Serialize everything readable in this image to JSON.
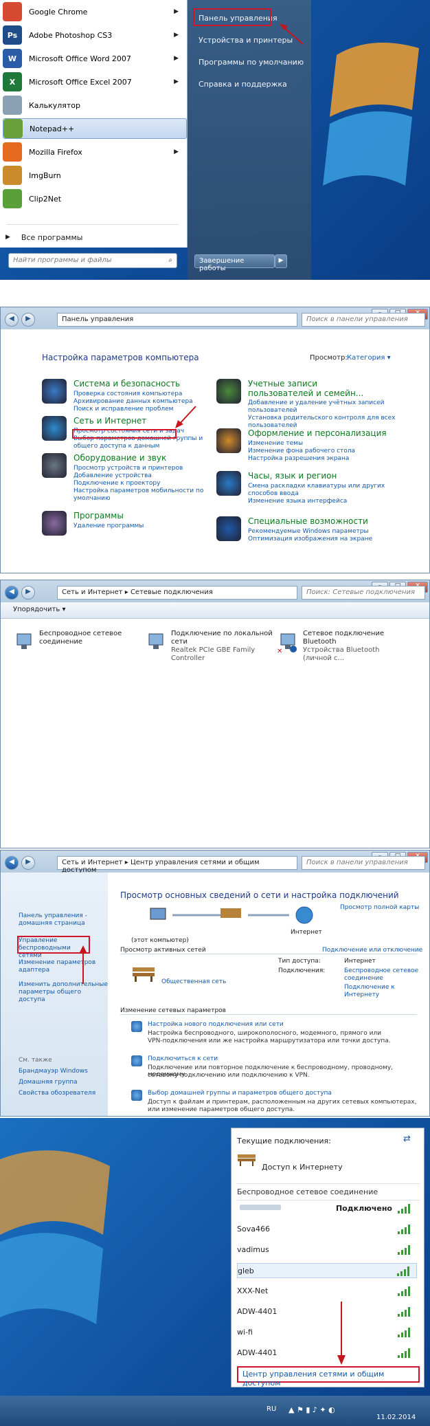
{
  "start_menu": {
    "programs": [
      {
        "label": "Google Chrome",
        "icon": "chrome-icon",
        "color": "#d64933",
        "arrow": true
      },
      {
        "label": "Adobe Photoshop CS3",
        "icon": "photoshop-icon",
        "color": "#1f4d8a",
        "arrow": true,
        "abbr": "Ps"
      },
      {
        "label": "Microsoft Office Word 2007",
        "icon": "word-icon",
        "color": "#2b5ca8",
        "arrow": true,
        "abbr": "W"
      },
      {
        "label": "Microsoft Office Excel 2007",
        "icon": "excel-icon",
        "color": "#1f7a3a",
        "arrow": true,
        "abbr": "X"
      },
      {
        "label": "Калькулятор",
        "icon": "calculator-icon",
        "color": "#8aa0b5",
        "arrow": false
      },
      {
        "label": "Notepad++",
        "icon": "notepadpp-icon",
        "color": "#6aa03a",
        "arrow": false
      },
      {
        "label": "Mozilla Firefox",
        "icon": "firefox-icon",
        "color": "#e66a1f",
        "arrow": true
      },
      {
        "label": "ImgBurn",
        "icon": "imgburn-icon",
        "color": "#c98b2b",
        "arrow": false
      },
      {
        "label": "Clip2Net",
        "icon": "clip2net-icon",
        "color": "#5aa03a",
        "arrow": false
      }
    ],
    "all_programs": "Все программы",
    "search_placeholder": "Найти программы и файлы",
    "right_items": [
      "Панель управления",
      "Устройства и принтеры",
      "Программы по умолчанию",
      "Справка и поддержка"
    ],
    "shutdown": "Завершение работы"
  },
  "control_panel": {
    "address": "Панель управления",
    "search": "Поиск в панели управления",
    "heading": "Настройка параметров компьютера",
    "view_label": "Просмотр:",
    "view_value": "Категория",
    "categories_left": [
      {
        "title": "Система и безопасность",
        "links": [
          "Проверка состояния компьютера",
          "Архивирование данных компьютера",
          "Поиск и исправление проблем"
        ],
        "icon": "shield-icon",
        "color": "#3a7bc8"
      },
      {
        "title": "Сеть и Интернет",
        "links": [
          "Просмотр состояния сети и задач",
          "Выбор параметров домашней группы и",
          "общего доступа к данным"
        ],
        "icon": "network-globe-icon",
        "color": "#2e8bd0"
      },
      {
        "title": "Оборудование и звук",
        "links": [
          "Просмотр устройств и принтеров",
          "Добавление устройства",
          "Подключение к проектору",
          "Настройка параметров мобильности по",
          "умолчанию"
        ],
        "icon": "printer-icon",
        "color": "#6a7680"
      },
      {
        "title": "Программы",
        "links": [
          "Удаление программы"
        ],
        "icon": "programs-icon",
        "color": "#8a6aa0"
      }
    ],
    "categories_right": [
      {
        "title": "Учетные записи пользователей и семейн...",
        "links": [
          "Добавление и удаление учётных записей",
          "пользователей",
          "Установка родительского контроля для всех",
          "пользователей"
        ],
        "icon": "users-icon",
        "color": "#4a8a3a"
      },
      {
        "title": "Оформление и персонализация",
        "links": [
          "Изменение темы",
          "Изменение фона рабочего стола",
          "Настройка разрешения экрана"
        ],
        "icon": "personalize-icon",
        "color": "#d08a2a"
      },
      {
        "title": "Часы, язык и регион",
        "links": [
          "Смена раскладки клавиатуры или других",
          "способов ввода",
          "Изменение языка интерфейса"
        ],
        "icon": "clock-globe-icon",
        "color": "#2a7ac8"
      },
      {
        "title": "Специальные возможности",
        "links": [
          "Рекомендуемые Windows параметры",
          "Оптимизация изображения на экране"
        ],
        "icon": "accessibility-icon",
        "color": "#1e5aa8"
      }
    ]
  },
  "net_connections": {
    "address": "Сеть и Интернет  ▸  Сетевые подключения",
    "search": "Поиск: Сетевые подключения",
    "organize": "Упорядочить",
    "items": [
      {
        "name": "Беспроводное сетевое",
        "name2": "соединение",
        "device": ""
      },
      {
        "name": "Подключение по локальной сети",
        "name2": "",
        "device": "Realtek PCIe GBE Family Controller"
      },
      {
        "name": "Сетевое подключение Bluetooth",
        "name2": "",
        "device": "Устройства Bluetooth (личной с..."
      }
    ]
  },
  "network_center": {
    "address": "Сеть и Интернет  ▸  Центр управления сетями и общим доступом",
    "search": "Поиск в панели управления",
    "sidebar": [
      "Панель управления -",
      "домашняя страница",
      "Управление беспроводными",
      "сетями",
      "Изменение параметров",
      "адаптера",
      "Изменить дополнительные",
      "параметры общего доступа"
    ],
    "see_also": "См. также",
    "see_also_items": [
      "Брандмауэр Windows",
      "Домашняя группа",
      "Свойства обозревателя"
    ],
    "title": "Просмотр основных сведений о сети и настройка подключений",
    "full_map": "Просмотр полной карты",
    "this_computer": "(этот компьютер)",
    "internet": "Интернет",
    "active_networks": "Просмотр активных сетей",
    "connect_disconnect": "Подключение или отключение",
    "public_network": "Общественная сеть",
    "access_type_label": "Тип доступа:",
    "access_type_value": "Интернет",
    "connections_label": "Подключения:",
    "connection_link1": "Беспроводное сетевое",
    "connection_link2": "соединение",
    "connect_to": "Подключение к",
    "connect_to2": "Интернету",
    "change_settings": "Изменение сетевых параметров",
    "tasks": [
      {
        "title": "Настройка нового подключения или сети",
        "desc": [
          "Настройка беспроводного, широкополосного, модемного, прямого или",
          "VPN-подключения или же настройка маршрутизатора или точки доступа."
        ]
      },
      {
        "title": "Подключиться к сети",
        "desc": [
          "Подключение или повторное подключение к беспроводному, проводному, модемному",
          "сетевому подключению или подключению к VPN."
        ]
      },
      {
        "title": "Выбор домашней группы и параметров общего доступа",
        "desc": [
          "Доступ к файлам и принтерам, расположенным на других сетевых компьютерах,",
          "или изменение параметров общего доступа."
        ]
      }
    ]
  },
  "wifi_popup": {
    "current": "Текущие подключения:",
    "internet_access": "Доступ к Интернету",
    "section": "Беспроводное сетевое соединение",
    "connected": "Подключено",
    "networks": [
      "Sova466",
      "vadimus",
      "gleb",
      "XXX-Net",
      "ADW-4401",
      "wi-fi",
      "ADW-4401"
    ],
    "footer_link": "Центр управления сетями и общим доступом",
    "lang": "RU",
    "date": "11.02.2014"
  }
}
